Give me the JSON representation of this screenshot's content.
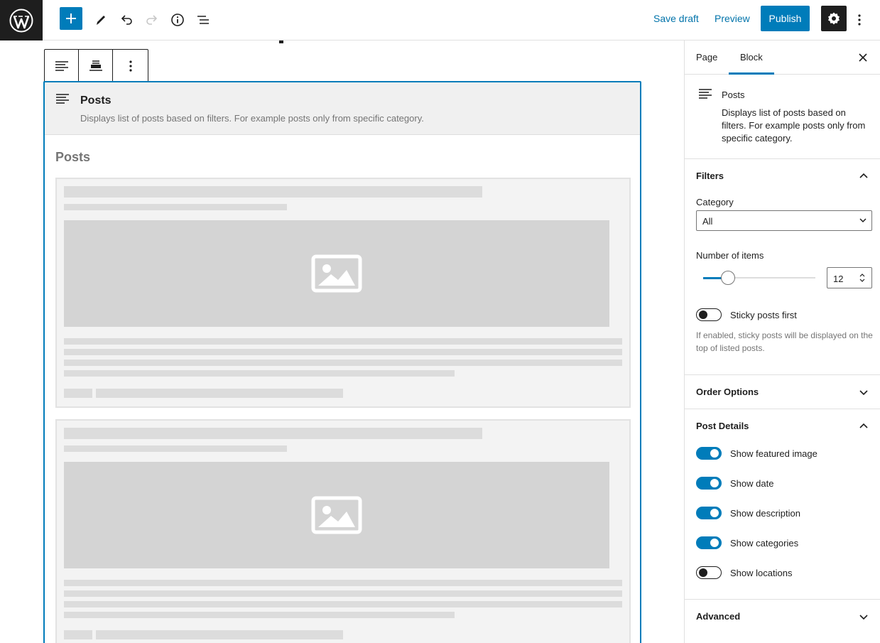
{
  "topbar": {
    "save_draft": "Save draft",
    "preview": "Preview",
    "publish": "Publish",
    "accent": "#007cba"
  },
  "block": {
    "title": "Posts",
    "description": "Displays list of posts based on filters. For example posts only from specific category.",
    "preview_heading": "Posts"
  },
  "sidebar": {
    "tabs": [
      "Page",
      "Block"
    ],
    "active_tab": "Block",
    "card": {
      "title": "Posts",
      "description": "Displays list of posts based on filters. For example posts only from specific category."
    },
    "filters": {
      "title": "Filters",
      "category_label": "Category",
      "category_value": "All",
      "items_label": "Number of items",
      "items_value": "12",
      "items_fraction": 0.22,
      "sticky_label": "Sticky posts first",
      "sticky_on": false,
      "sticky_help": "If enabled, sticky posts will be displayed on the top of listed posts."
    },
    "order": {
      "title": "Order Options"
    },
    "details": {
      "title": "Post Details",
      "toggles": [
        {
          "label": "Show featured image",
          "on": true
        },
        {
          "label": "Show date",
          "on": true
        },
        {
          "label": "Show description",
          "on": true
        },
        {
          "label": "Show categories",
          "on": true
        },
        {
          "label": "Show locations",
          "on": false
        }
      ]
    },
    "advanced": {
      "title": "Advanced"
    }
  }
}
